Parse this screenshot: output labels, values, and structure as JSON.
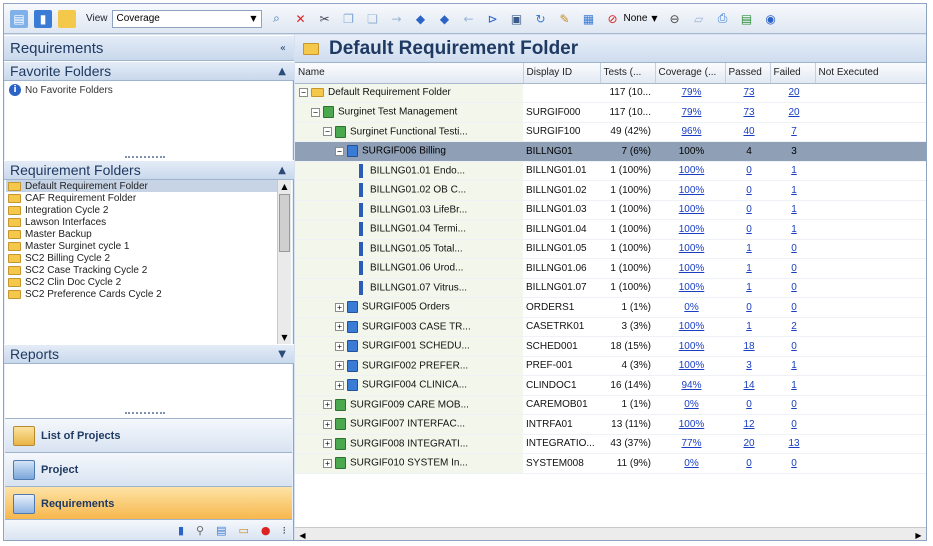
{
  "toolbar": {
    "view_label": "View",
    "view_value": "Coverage",
    "none_label": "None",
    "icons": [
      "new-requirement-icon",
      "new-folder-icon",
      "folder-open-icon",
      "find-icon",
      "delete-icon",
      "cut-icon",
      "copy-icon",
      "paste-icon",
      "indent-icon",
      "move-up-icon",
      "move-down-icon",
      "outdent-icon",
      "filter-icon",
      "save-icon",
      "refresh-icon",
      "edit-icon",
      "report-icon",
      "none-filter-icon",
      "coverage-icon",
      "notes-icon",
      "print-icon",
      "export-icon",
      "help-icon"
    ]
  },
  "left": {
    "requirements_title": "Requirements",
    "favorites_title": "Favorite Folders",
    "favorites_empty": "No Favorite Folders",
    "folders_title": "Requirement Folders",
    "folders": [
      "Default Requirement Folder",
      "CAF Requirement Folder",
      "Integration Cycle 2",
      "Lawson Interfaces",
      "Master Backup",
      "Master Surginet cycle 1",
      "SC2 Billing Cycle 2",
      "SC2 Case Tracking Cycle 2",
      "SC2 Clin Doc Cycle 2",
      "SC2 Preference Cards Cycle 2"
    ],
    "reports_title": "Reports",
    "nav": {
      "projects": "List of Projects",
      "project": "Project",
      "requirements": "Requirements"
    }
  },
  "main": {
    "title": "Default Requirement Folder",
    "columns": [
      "Name",
      "Display ID",
      "Tests (...",
      "Coverage (...",
      "Passed",
      "Failed",
      "Not Executed"
    ],
    "rows": [
      {
        "name": "Default Requirement Folder",
        "id": "",
        "tests": "117 (10...",
        "coverage": "79%",
        "passed": "73",
        "failed": "20",
        "expander": "−",
        "icon": "folder"
      },
      {
        "name": "Surginet Test Management",
        "id": "SURGIF000",
        "tests": "117 (10...",
        "coverage": "79%",
        "passed": "73",
        "failed": "20",
        "expander": "−",
        "icon": "green"
      },
      {
        "name": "Surginet Functional Testi...",
        "id": "SURGIF100",
        "tests": "49 (42%)",
        "coverage": "96%",
        "passed": "40",
        "failed": "7",
        "expander": "−",
        "icon": "green"
      },
      {
        "name": "SURGIF006 Billing",
        "id": "BILLNG01",
        "tests": "7 (6%)",
        "coverage": "100%",
        "passed": "4",
        "failed": "3",
        "expander": "−",
        "icon": "blue",
        "selected": true
      },
      {
        "name": "BILLNG01.01 Endo...",
        "id": "BILLNG01.01",
        "tests": "1 (100%)",
        "coverage": "100%",
        "passed": "0",
        "failed": "1",
        "expander": "",
        "icon": "leaf"
      },
      {
        "name": "BILLNG01.02 OB C...",
        "id": "BILLNG01.02",
        "tests": "1 (100%)",
        "coverage": "100%",
        "passed": "0",
        "failed": "1",
        "expander": "",
        "icon": "leaf"
      },
      {
        "name": "BILLNG01.03 LifeBr...",
        "id": "BILLNG01.03",
        "tests": "1 (100%)",
        "coverage": "100%",
        "passed": "0",
        "failed": "1",
        "expander": "",
        "icon": "leaf"
      },
      {
        "name": "BILLNG01.04 Termi...",
        "id": "BILLNG01.04",
        "tests": "1 (100%)",
        "coverage": "100%",
        "passed": "0",
        "failed": "1",
        "expander": "",
        "icon": "leaf"
      },
      {
        "name": "BILLNG01.05 Total...",
        "id": "BILLNG01.05",
        "tests": "1 (100%)",
        "coverage": "100%",
        "passed": "1",
        "failed": "0",
        "expander": "",
        "icon": "leaf"
      },
      {
        "name": "BILLNG01.06 Urod...",
        "id": "BILLNG01.06",
        "tests": "1 (100%)",
        "coverage": "100%",
        "passed": "1",
        "failed": "0",
        "expander": "",
        "icon": "leaf"
      },
      {
        "name": "BILLNG01.07 Vitrus...",
        "id": "BILLNG01.07",
        "tests": "1 (100%)",
        "coverage": "100%",
        "passed": "1",
        "failed": "0",
        "expander": "",
        "icon": "leaf"
      },
      {
        "name": "SURGIF005 Orders",
        "id": "ORDERS1",
        "tests": "1 (1%)",
        "coverage": "0%",
        "passed": "0",
        "failed": "0",
        "expander": "+",
        "icon": "blue"
      },
      {
        "name": "SURGIF003 CASE TR...",
        "id": "CASETRK01",
        "tests": "3 (3%)",
        "coverage": "100%",
        "passed": "1",
        "failed": "2",
        "expander": "+",
        "icon": "blue"
      },
      {
        "name": "SURGIF001 SCHEDU...",
        "id": "SCHED001",
        "tests": "18 (15%)",
        "coverage": "100%",
        "passed": "18",
        "failed": "0",
        "expander": "+",
        "icon": "blue"
      },
      {
        "name": "SURGIF002 PREFER...",
        "id": "PREF-001",
        "tests": "4 (3%)",
        "coverage": "100%",
        "passed": "3",
        "failed": "1",
        "expander": "+",
        "icon": "blue"
      },
      {
        "name": "SURGIF004 CLINICA...",
        "id": "CLINDOC1",
        "tests": "16 (14%)",
        "coverage": "94%",
        "passed": "14",
        "failed": "1",
        "expander": "+",
        "icon": "blue"
      },
      {
        "name": "SURGIF009 CARE MOB...",
        "id": "CAREMOB01",
        "tests": "1 (1%)",
        "coverage": "0%",
        "passed": "0",
        "failed": "0",
        "expander": "+",
        "icon": "green"
      },
      {
        "name": "SURGIF007 INTERFAC...",
        "id": "INTRFA01",
        "tests": "13 (11%)",
        "coverage": "100%",
        "passed": "12",
        "failed": "0",
        "expander": "+",
        "icon": "green"
      },
      {
        "name": "SURGIF008 INTEGRATI...",
        "id": "INTEGRATIO...",
        "tests": "43 (37%)",
        "coverage": "77%",
        "passed": "20",
        "failed": "13",
        "expander": "+",
        "icon": "green"
      },
      {
        "name": "SURGIF010 SYSTEM In...",
        "id": "SYSTEM008",
        "tests": "11 (9%)",
        "coverage": "0%",
        "passed": "0",
        "failed": "0",
        "expander": "+",
        "icon": "green"
      }
    ],
    "indents": [
      0,
      1,
      2,
      3,
      5,
      5,
      5,
      5,
      5,
      5,
      5,
      3,
      3,
      3,
      3,
      3,
      2,
      2,
      2,
      2
    ]
  }
}
